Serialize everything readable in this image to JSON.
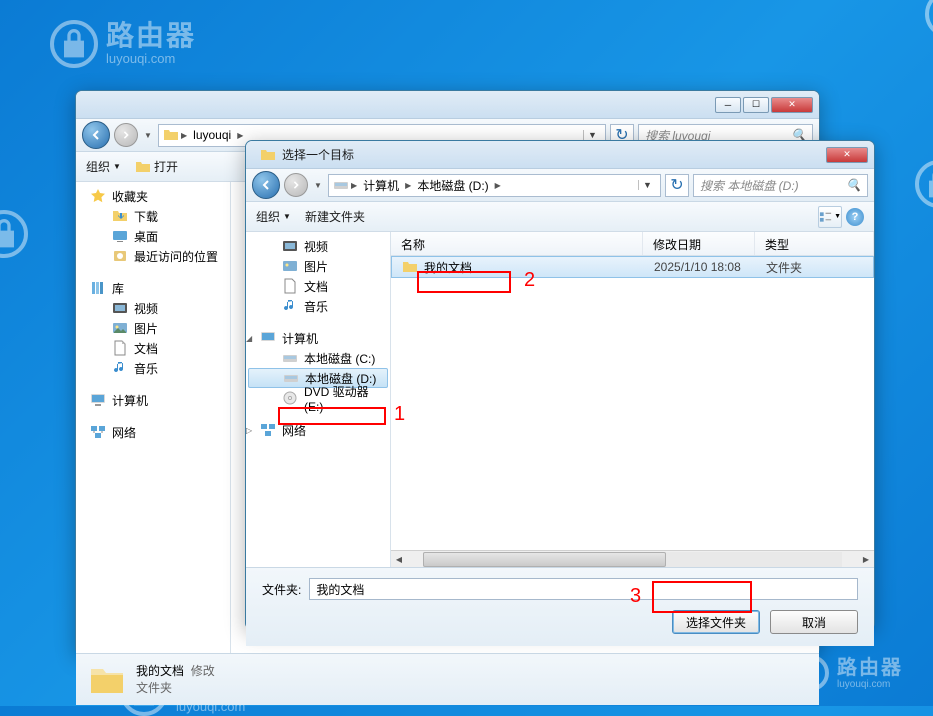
{
  "watermark": {
    "title": "路由器",
    "sub": "luyouqi.com"
  },
  "back_window": {
    "breadcrumb": "luyouqi",
    "search_placeholder": "搜索 luyouqi",
    "toolbar": {
      "organize": "组织",
      "open": "打开"
    },
    "sidebar": {
      "favorites": "收藏夹",
      "downloads": "下载",
      "desktop": "桌面",
      "recent": "最近访问的位置",
      "libraries": "库",
      "videos": "视频",
      "pictures": "图片",
      "documents": "文档",
      "music": "音乐",
      "computer": "计算机",
      "network": "网络"
    },
    "status": {
      "name": "我的文档",
      "modified_label": "修改",
      "type": "文件夹"
    }
  },
  "front_window": {
    "title": "选择一个目标",
    "breadcrumb": {
      "computer": "计算机",
      "drive": "本地磁盘 (D:)"
    },
    "search_placeholder": "搜索 本地磁盘 (D:)",
    "toolbar": {
      "organize": "组织",
      "new_folder": "新建文件夹"
    },
    "sidebar": {
      "videos": "视频",
      "pictures": "图片",
      "documents": "文档",
      "music": "音乐",
      "computer": "计算机",
      "drive_c": "本地磁盘 (C:)",
      "drive_d": "本地磁盘 (D:)",
      "dvd": "DVD 驱动器 (E:)",
      "network": "网络"
    },
    "columns": {
      "name": "名称",
      "date": "修改日期",
      "type": "类型"
    },
    "rows": [
      {
        "name": "我的文档",
        "date": "2025/1/10 18:08",
        "type": "文件夹"
      }
    ],
    "folder_label": "文件夹:",
    "folder_value": "我的文档",
    "select_button": "选择文件夹",
    "cancel_button": "取消"
  },
  "annotations": {
    "n1": "1",
    "n2": "2",
    "n3": "3"
  }
}
